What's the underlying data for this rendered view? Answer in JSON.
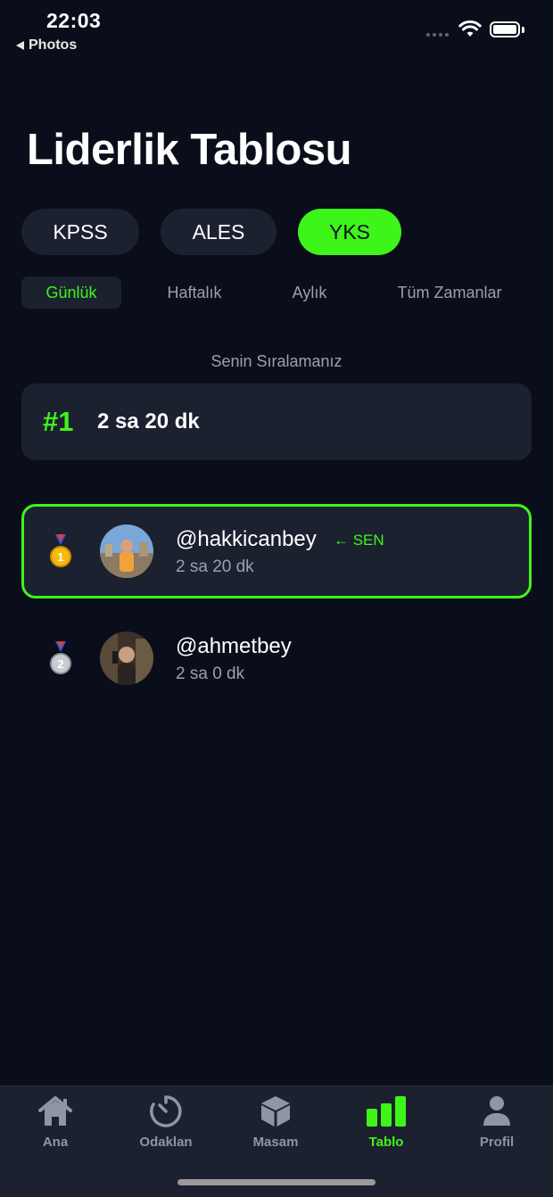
{
  "status_bar": {
    "time": "22:03",
    "back_label": "Photos"
  },
  "title": "Liderlik Tablosu",
  "exam_tabs": [
    {
      "label": "KPSS",
      "active": false
    },
    {
      "label": "ALES",
      "active": false
    },
    {
      "label": "YKS",
      "active": true
    }
  ],
  "period_tabs": [
    {
      "label": "Günlük",
      "active": true
    },
    {
      "label": "Haftalık",
      "active": false
    },
    {
      "label": "Aylık",
      "active": false
    },
    {
      "label": "Tüm Zamanlar",
      "active": false
    }
  ],
  "my_rank": {
    "label": "Senin Sıralamanız",
    "rank": "#1",
    "time": "2 sa 20 dk"
  },
  "leaderboard": [
    {
      "medal": "gold",
      "medal_num": "1",
      "username": "@hakkicanbey",
      "you_label": "← SEN",
      "time": "2 sa 20 dk",
      "is_me": true
    },
    {
      "medal": "silver",
      "medal_num": "2",
      "username": "@ahmetbey",
      "you_label": "",
      "time": "2 sa 0 dk",
      "is_me": false
    }
  ],
  "tab_bar": [
    {
      "label": "Ana",
      "icon": "home-icon",
      "active": false
    },
    {
      "label": "Odaklan",
      "icon": "timer-icon",
      "active": false
    },
    {
      "label": "Masam",
      "icon": "cube-icon",
      "active": false
    },
    {
      "label": "Tablo",
      "icon": "bar-chart-icon",
      "active": true
    },
    {
      "label": "Profil",
      "icon": "person-icon",
      "active": false
    }
  ],
  "colors": {
    "background": "#0a0e1a",
    "card": "#1c2130",
    "accent": "#3ef51a",
    "muted": "#9aa0ad"
  }
}
